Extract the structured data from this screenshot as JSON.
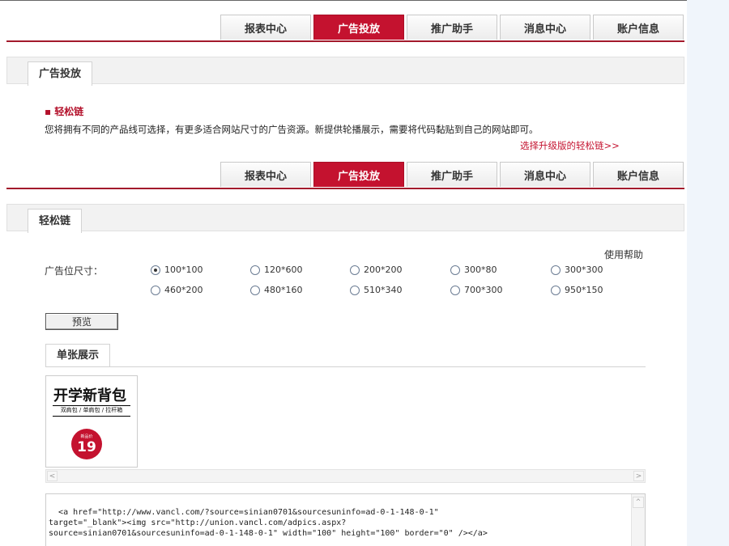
{
  "nav": {
    "tabs": [
      {
        "label": "报表中心",
        "active": false
      },
      {
        "label": "广告投放",
        "active": true
      },
      {
        "label": "推广助手",
        "active": false
      },
      {
        "label": "消息中心",
        "active": false
      },
      {
        "label": "账户信息",
        "active": false
      }
    ]
  },
  "ad_section": {
    "tab_label": "广告投放",
    "subtitle": "▪ 轻松链",
    "description": "您将拥有不同的产品线可选择，有更多适合网站尺寸的广告资源。新提供轮播展示，需要将代码黏贴到自己的网站即可。",
    "upgrade_link": "选择升级版的轻松链>>"
  },
  "easy_link": {
    "tab_label": "轻松链",
    "help_link": "使用帮助",
    "size_label": "广告位尺寸：",
    "sizes": [
      "100*100",
      "120*600",
      "200*200",
      "300*80",
      "300*300",
      "460*200",
      "480*160",
      "510*340",
      "700*300",
      "950*150"
    ],
    "selected_size": "100*100",
    "preview_button": "预览",
    "single_tab": "单张展示",
    "ad": {
      "headline": "开学新背包",
      "subline": "双肩包 / 单肩包 / 拉杆箱",
      "badge_small": "新品价",
      "price": "19"
    },
    "code": "<a href=\"http://www.vancl.com/?source=sinian0701&sourcesuninfo=ad-0-1-148-0-1\"\ntarget=\"_blank\"><img src=\"http://union.vancl.com/adpics.aspx?\nsource=sinian0701&sourcesuninfo=ad-0-1-148-0-1\" width=\"100\" height=\"100\" border=\"0\" /></a>"
  },
  "colors": {
    "accent": "#c4122f",
    "panel_bg": "#f2f2f2",
    "side_bg": "#f0f5fb"
  }
}
